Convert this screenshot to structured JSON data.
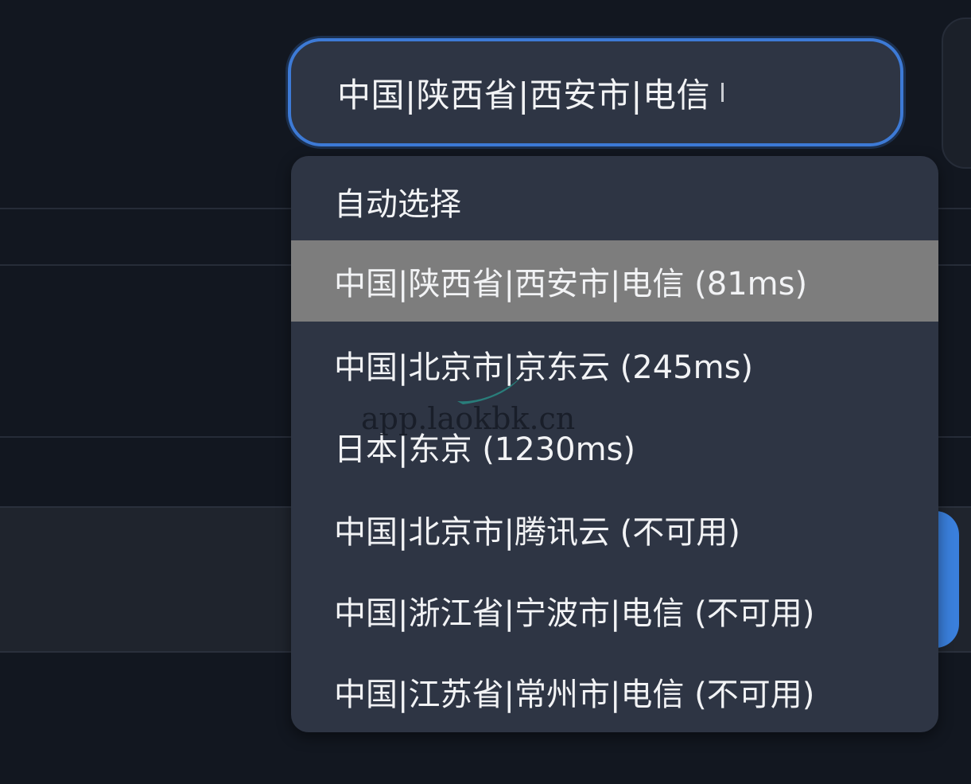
{
  "select": {
    "value": "中国|陕西省|西安市|电信"
  },
  "dropdown": {
    "options": [
      {
        "label": "自动选择",
        "selected": false
      },
      {
        "label": "中国|陕西省|西安市|电信 (81ms)",
        "selected": true
      },
      {
        "label": "中国|北京市|京东云 (245ms)",
        "selected": false
      },
      {
        "label": "日本|东京 (1230ms)",
        "selected": false
      },
      {
        "label": "中国|北京市|腾讯云 (不可用)",
        "selected": false
      },
      {
        "label": "中国|浙江省|宁波市|电信 (不可用)",
        "selected": false
      },
      {
        "label": "中国|江苏省|常州市|电信 (不可用)",
        "selected": false
      }
    ]
  },
  "watermark": {
    "url": "app.laokbk.cn"
  },
  "colors": {
    "background": "#121720",
    "field_background": "#2e3544",
    "focus_border": "#3d7ad6",
    "selected_option": "#7d7d7d",
    "text": "#f2f3f5",
    "accent_button": "#3a7fdc"
  }
}
